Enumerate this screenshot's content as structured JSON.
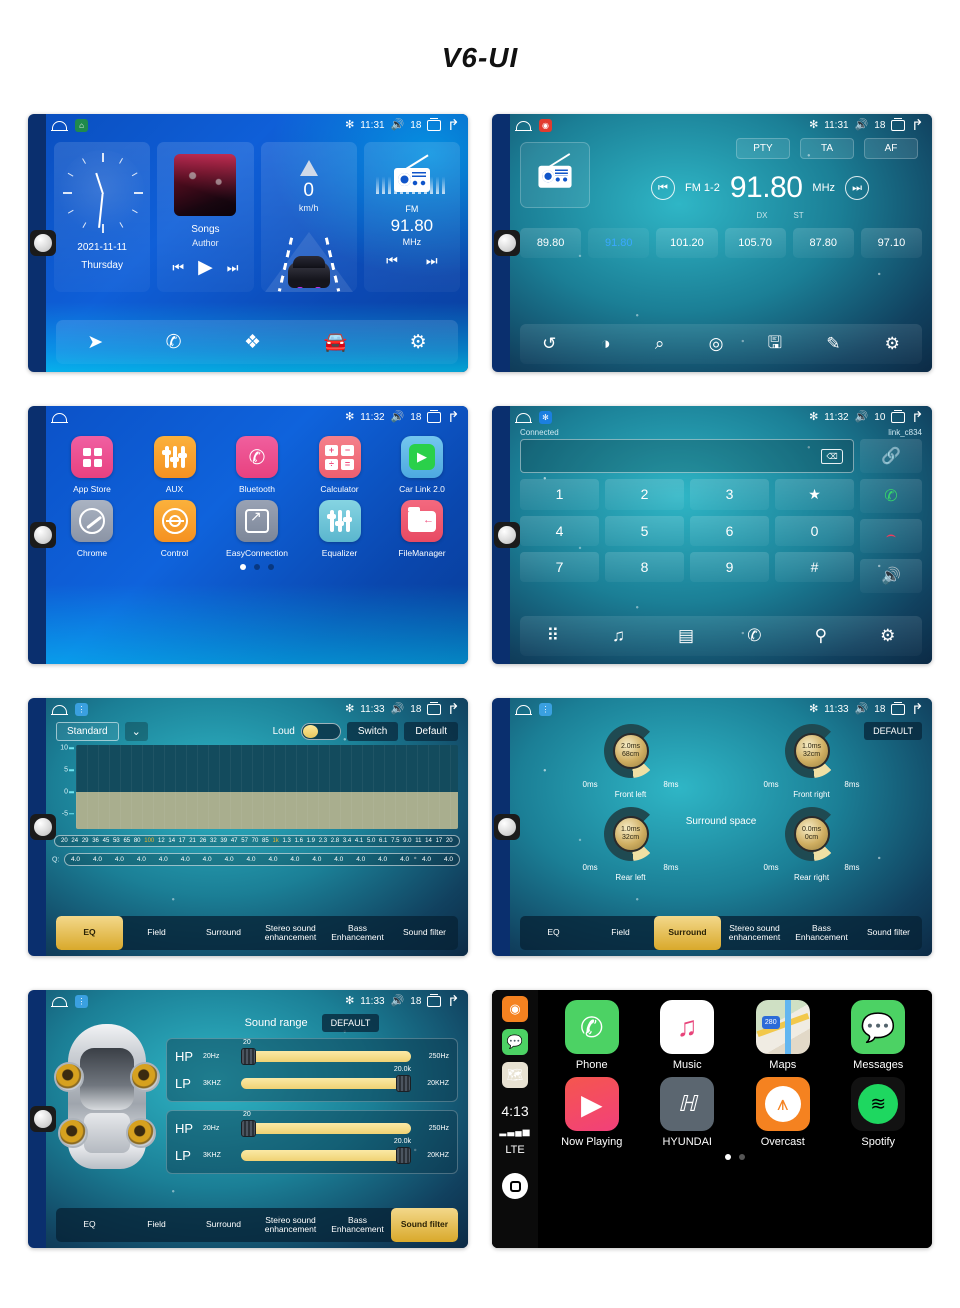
{
  "page": {
    "title": "V6-UI"
  },
  "statusbar": {
    "bt_icon": "bluetooth-icon",
    "time_1": "11:31",
    "time_2": "11:32",
    "time_3": "11:33",
    "vol_18": "18",
    "vol_10": "10"
  },
  "screens": {
    "home": {
      "clock": {
        "date": "2021-11-11",
        "weekday": "Thursday"
      },
      "music": {
        "title": "Songs",
        "artist": "Author"
      },
      "nav": {
        "speed": "0",
        "unit": "km/h"
      },
      "radio": {
        "band": "FM",
        "freq": "91.80",
        "unit": "MHz"
      },
      "dock": [
        {
          "name": "navigation-icon",
          "glyph": "➤"
        },
        {
          "name": "phone-icon",
          "glyph": "✆"
        },
        {
          "name": "apps-icon",
          "glyph": "▦"
        },
        {
          "name": "carlink-icon",
          "glyph": "🚗"
        },
        {
          "name": "settings-icon",
          "glyph": "⚙"
        }
      ]
    },
    "radio": {
      "pills": [
        "PTY",
        "TA",
        "AF"
      ],
      "band": "FM 1-2",
      "freq": "91.80",
      "unit": "MHz",
      "dx": "DX",
      "st": "ST",
      "presets": [
        {
          "freq": "89.80",
          "active": false
        },
        {
          "freq": "91.80",
          "active": true
        },
        {
          "freq": "101.20",
          "active": false
        },
        {
          "freq": "105.70",
          "active": false
        },
        {
          "freq": "87.80",
          "active": false
        },
        {
          "freq": "97.10",
          "active": false
        }
      ],
      "toolbar": [
        "loop-icon",
        "contrast-icon",
        "search-icon",
        "scan-icon",
        "save-icon",
        "edit-icon",
        "settings-icon"
      ]
    },
    "apps": {
      "row1": [
        {
          "label": "App Store",
          "icon": "appstore-icon",
          "color": "#ef4d8f"
        },
        {
          "label": "AUX",
          "icon": "aux-icon",
          "color": "#f79b28"
        },
        {
          "label": "Bluetooth",
          "icon": "bluetooth-phone-icon",
          "color": "#ee4e8e"
        },
        {
          "label": "Calculator",
          "icon": "calculator-icon",
          "color": "#f26a74"
        },
        {
          "label": "Car Link 2.0",
          "icon": "carlink-icon",
          "color": "#5fb8e8"
        }
      ],
      "row2": [
        {
          "label": "Chrome",
          "icon": "chrome-compass-icon",
          "color": "#9aa3b3"
        },
        {
          "label": "Control",
          "icon": "steering-wheel-icon",
          "color": "#f79b28"
        },
        {
          "label": "EasyConnection",
          "icon": "easyconnection-icon",
          "color": "#8b93a5"
        },
        {
          "label": "Equalizer",
          "icon": "equalizer-icon",
          "color": "#6fc4d6"
        },
        {
          "label": "FileManager",
          "icon": "filemanager-icon",
          "color": "#ef5470"
        }
      ],
      "pages": 3,
      "active_page": 1
    },
    "bluetooth": {
      "status": "Connected",
      "device": "link_c834",
      "input_value": "",
      "keys_row1": [
        "1",
        "2",
        "3",
        "★"
      ],
      "keys_row2": [
        "4",
        "5",
        "6",
        "0"
      ],
      "keys_row3": [
        "7",
        "8",
        "9",
        "#"
      ],
      "side": [
        "link-icon",
        "call-icon",
        "end-call-icon",
        "speaker-icon"
      ],
      "toolbar": [
        "keypad-icon",
        "music-icon",
        "contacts-icon",
        "call-log-icon",
        "connect-icon",
        "settings-icon"
      ]
    },
    "eq": {
      "preset": "Standard",
      "loud_label": "Loud",
      "loud_on": true,
      "switch_label": "Switch",
      "default_label": "Default",
      "q_label": "Q:",
      "yaxis": [
        "10",
        "5",
        "0",
        "-5"
      ],
      "frequencies": [
        "20",
        "24",
        "29",
        "36",
        "45",
        "53",
        "65",
        "80",
        "100",
        "12",
        "14",
        "17",
        "21",
        "26",
        "32",
        "39",
        "47",
        "57",
        "70",
        "85",
        "1k",
        "1.3",
        "1.6",
        "1.9",
        "2.3",
        "2.8",
        "3.4",
        "4.1",
        "5.0",
        "6.1",
        "7.5",
        "9.0",
        "11",
        "14",
        "17",
        "20"
      ],
      "highlight_freqs": [
        "100",
        "1k"
      ],
      "q_values": [
        "4.0",
        "4.0",
        "4.0",
        "4.0",
        "4.0",
        "4.0",
        "4.0",
        "4.0",
        "4.0",
        "4.0",
        "4.0",
        "4.0",
        "4.0",
        "4.0",
        "4.0",
        "4.0",
        "4.0",
        "4.0"
      ],
      "tabs": [
        "EQ",
        "Field",
        "Surround",
        "Stereo sound enhancement",
        "Bass Enhancement",
        "Sound filter"
      ],
      "active_tab": "EQ"
    },
    "surround": {
      "default_label": "DEFAULT",
      "center_label": "Surround space",
      "knobs": [
        {
          "label": "Front left",
          "value_ms": "2.0ms",
          "value_cm": "68cm",
          "min": "0ms",
          "max": "8ms"
        },
        {
          "label": "Front right",
          "value_ms": "1.0ms",
          "value_cm": "32cm",
          "min": "0ms",
          "max": "8ms"
        },
        {
          "label": "Rear left",
          "value_ms": "1.0ms",
          "value_cm": "32cm",
          "min": "0ms",
          "max": "8ms"
        },
        {
          "label": "Rear right",
          "value_ms": "0.0ms",
          "value_cm": "0cm",
          "min": "0ms",
          "max": "8ms"
        }
      ],
      "tabs": [
        "EQ",
        "Field",
        "Surround",
        "Stereo sound enhancement",
        "Bass Enhancement",
        "Sound filter"
      ],
      "active_tab": "Surround"
    },
    "soundfilter": {
      "title": "Sound range",
      "default_label": "DEFAULT",
      "group1": [
        {
          "name": "HP",
          "min": "20Hz",
          "max": "250Hz",
          "value": "20"
        },
        {
          "name": "LP",
          "min": "3KHZ",
          "max": "20KHZ",
          "value": "20.0k"
        }
      ],
      "group2": [
        {
          "name": "HP",
          "min": "20Hz",
          "max": "250Hz",
          "value": "20"
        },
        {
          "name": "LP",
          "min": "3KHZ",
          "max": "20KHZ",
          "value": "20.0k"
        }
      ],
      "tabs": [
        "EQ",
        "Field",
        "Surround",
        "Stereo sound enhancement",
        "Bass Enhancement",
        "Sound filter"
      ],
      "active_tab": "Sound filter"
    },
    "carplay": {
      "time": "4:13",
      "signal": "▂▃▄▅",
      "network": "LTE",
      "row1": [
        {
          "label": "Phone",
          "icon": "phone-icon",
          "color": "#4cd264"
        },
        {
          "label": "Music",
          "icon": "apple-music-icon",
          "color": "#ffffff"
        },
        {
          "label": "Maps",
          "icon": "maps-icon",
          "color": "#e8e2d2"
        },
        {
          "label": "Messages",
          "icon": "messages-icon",
          "color": "#4cd264"
        }
      ],
      "row2": [
        {
          "label": "Now Playing",
          "icon": "now-playing-icon",
          "color": "#f5455c"
        },
        {
          "label": "HYUNDAI",
          "icon": "hyundai-icon",
          "color": "#5b6670"
        },
        {
          "label": "Overcast",
          "icon": "overcast-icon",
          "color": "#f58220"
        },
        {
          "label": "Spotify",
          "icon": "spotify-icon",
          "color": "#121212"
        }
      ],
      "pages": 2,
      "active_page": 1
    }
  }
}
